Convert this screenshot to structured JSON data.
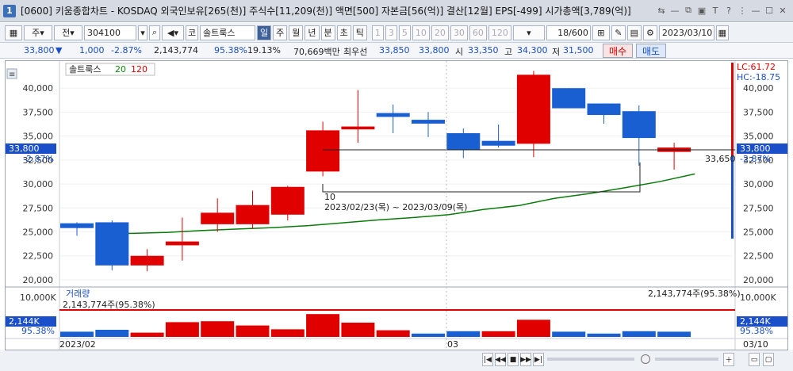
{
  "window": {
    "number": "1",
    "title": "[0600] 키움종합차트 - KOSDAQ 외국인보유[265(천)] 주식수[11,209(천)] 액면[500] 자본금[56(억)] 결산[12월] EPS[-499] 시가총액[3,789(억)]",
    "buttons": [
      "⇆",
      "—",
      "⧉",
      "▣",
      "T",
      "?",
      "⋮",
      "—",
      "☐",
      "✕"
    ]
  },
  "toolbar": {
    "market": "주",
    "type": "전",
    "code": "304100",
    "name_prefix": "코",
    "name": "솔트룩스",
    "periods": [
      "일",
      "주",
      "월",
      "년",
      "분",
      "초",
      "틱"
    ],
    "selected_period": "일",
    "intervals": [
      "1",
      "3",
      "5",
      "10",
      "20",
      "30",
      "60",
      "120"
    ],
    "count": "18",
    "count_total": "/600",
    "date": "2023/03/10"
  },
  "quote": {
    "price": "33,800",
    "change_arrow": "▼",
    "change": "1,000",
    "change_pct": "-2.87%",
    "volume": "2,143,774",
    "vol_ratio": "95.38%",
    "turnover": "19.13%",
    "amount": "70,669백만",
    "best_label": "최우선",
    "ask": "33,850",
    "bid": "33,800",
    "open_label": "시",
    "open": "33,350",
    "high_label": "고",
    "high": "34,300",
    "low_label": "저",
    "low": "31,500",
    "buy_label": "매수",
    "sell_label": "매도"
  },
  "chart_panel": {
    "legend_name": "솔트룩스",
    "ma_short": "20",
    "ma_long": "120",
    "lc_label": "LC:61.72",
    "hc_label": "HC:-18.75",
    "price_tag": "33,800",
    "pct_tag": "-2.87%",
    "low_annot": "33,650",
    "range_count": "10",
    "range_text": "2023/02/23(목) ~ 2023/03/09(목)",
    "x_labels": [
      "2023/02",
      "03",
      "03/10"
    ]
  },
  "volume_panel": {
    "title": "거래량",
    "left_annot": "2,143,774주(95.38%)",
    "right_annot": "2,143,774주(95.38%)",
    "y_label": "10,000K",
    "tag": "2,144K",
    "tag_pct": "95.38%"
  },
  "chart_data": {
    "type": "candlestick",
    "y_ticks": [
      "40,000",
      "37,500",
      "35,000",
      "32,500",
      "30,000",
      "27,500",
      "25,000",
      "22,500",
      "20,000"
    ],
    "ylim": [
      19500,
      42500
    ],
    "candles": [
      {
        "o": 25400,
        "h": 26000,
        "l": 24600,
        "c": 25900,
        "up": false
      },
      {
        "o": 26000,
        "h": 26200,
        "l": 21000,
        "c": 21500,
        "up": false
      },
      {
        "o": 21500,
        "h": 23200,
        "l": 20900,
        "c": 22500,
        "up": true
      },
      {
        "o": 23600,
        "h": 26500,
        "l": 22000,
        "c": 24000,
        "up": true
      },
      {
        "o": 25800,
        "h": 28500,
        "l": 25000,
        "c": 27000,
        "up": true
      },
      {
        "o": 25800,
        "h": 29300,
        "l": 25300,
        "c": 27800,
        "up": true
      },
      {
        "o": 26800,
        "h": 29800,
        "l": 26200,
        "c": 29700,
        "up": true
      },
      {
        "o": 31300,
        "h": 36500,
        "l": 30800,
        "c": 35600,
        "up": true
      },
      {
        "o": 35700,
        "h": 39800,
        "l": 34300,
        "c": 36000,
        "up": true
      },
      {
        "o": 37400,
        "h": 38300,
        "l": 35300,
        "c": 37000,
        "up": false
      },
      {
        "o": 36700,
        "h": 37500,
        "l": 34900,
        "c": 36300,
        "up": false
      },
      {
        "o": 35300,
        "h": 35800,
        "l": 32700,
        "c": 33600,
        "up": false
      },
      {
        "o": 34500,
        "h": 36200,
        "l": 33800,
        "c": 34000,
        "up": false
      },
      {
        "o": 34200,
        "h": 41800,
        "l": 32800,
        "c": 41400,
        "up": true
      },
      {
        "o": 40000,
        "h": 40000,
        "l": 37900,
        "c": 37900,
        "up": false
      },
      {
        "o": 38400,
        "h": 38400,
        "l": 36300,
        "c": 37200,
        "up": false
      },
      {
        "o": 37600,
        "h": 38200,
        "l": 31900,
        "c": 34800,
        "up": false
      },
      {
        "o": 33350,
        "h": 34300,
        "l": 31500,
        "c": 33800,
        "up": true
      }
    ],
    "ma20": [
      null,
      24800,
      24850,
      24950,
      25150,
      25300,
      25450,
      25650,
      25950,
      26250,
      26500,
      26800,
      27350,
      27750,
      28500,
      29000,
      29600,
      30250,
      31050
    ],
    "volume_k": [
      1100,
      1500,
      900,
      3100,
      3300,
      2400,
      1600,
      4800,
      3000,
      1400,
      700,
      1200,
      1200,
      3600,
      1100,
      700,
      1200,
      1100
    ],
    "volume_up": [
      false,
      false,
      true,
      true,
      true,
      true,
      true,
      true,
      true,
      true,
      false,
      false,
      true,
      true,
      false,
      false,
      false,
      false
    ],
    "volume_ylim": [
      0,
      10000
    ]
  }
}
